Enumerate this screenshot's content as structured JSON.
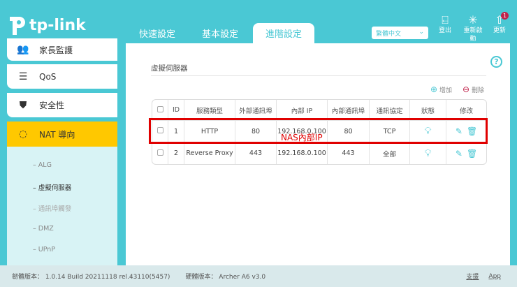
{
  "brand": "tp-link",
  "tabs": [
    {
      "label": "快速設定"
    },
    {
      "label": "基本設定"
    },
    {
      "label": "進階設定",
      "active": true
    }
  ],
  "language": "繁體中文",
  "header_actions": {
    "logout": "登出",
    "reboot": "重新啟動",
    "update": "更新",
    "update_badge": "1"
  },
  "sidebar": {
    "items": [
      {
        "label": "家長監護"
      },
      {
        "label": "QoS"
      },
      {
        "label": "安全性"
      },
      {
        "label": "NAT 導向",
        "active": true
      }
    ],
    "subitems": [
      {
        "label": "ALG"
      },
      {
        "label": "虛擬伺服器",
        "active": true
      },
      {
        "label": "通訊埠觸發"
      },
      {
        "label": "DMZ"
      },
      {
        "label": "UPnP"
      }
    ]
  },
  "main": {
    "title": "虛擬伺服器",
    "add": "增加",
    "delete": "刪除",
    "columns": [
      "ID",
      "服務類型",
      "外部通訊埠",
      "內部 IP",
      "內部通訊埠",
      "通訊協定",
      "狀態",
      "修改"
    ],
    "rows": [
      [
        "1",
        "HTTP",
        "80",
        "192.168.0.100",
        "80",
        "TCP"
      ],
      [
        "2",
        "Reverse Proxy",
        "443",
        "192.168.0.100",
        "443",
        "全部"
      ]
    ],
    "annotation": "NAS內部IP"
  },
  "footer": {
    "firmware": "韌體版本： 1.0.14 Build 20211118 rel.43110(5457)",
    "hardware": "硬體版本： Archer A6 v3.0",
    "support": "支援",
    "app": "App"
  },
  "colors": {
    "accent": "#4ac8d4",
    "active_menu": "#ffc800",
    "annotation": "#e00000"
  }
}
